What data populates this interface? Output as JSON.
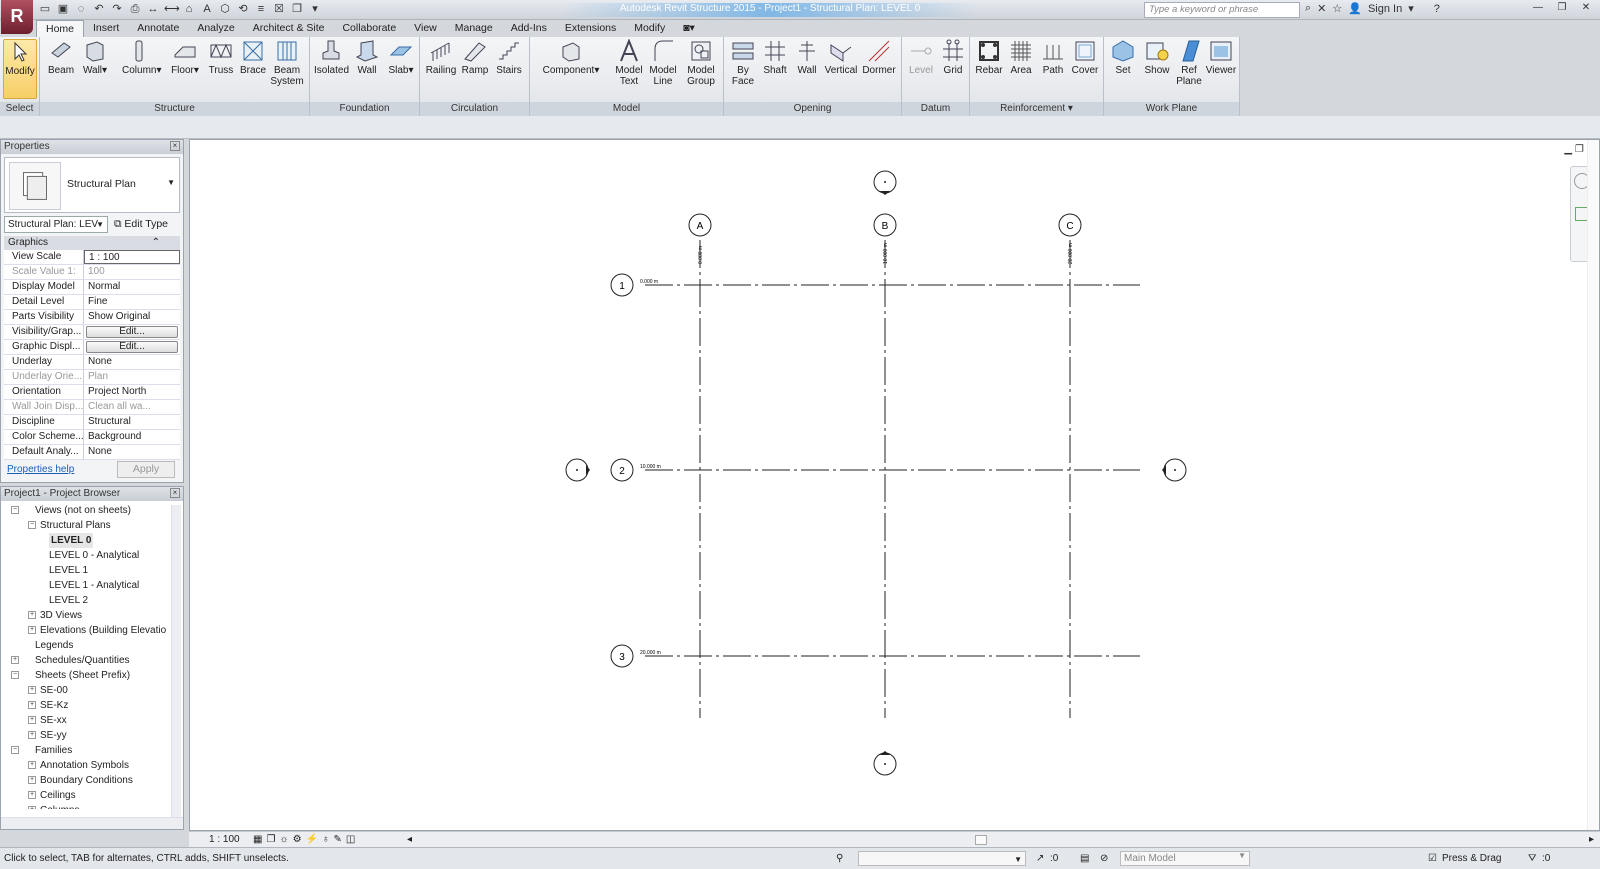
{
  "app": {
    "title": "Autodesk Revit Structure 2015 - Project1 - Structural Plan: LEVEL 0",
    "search_placeholder": "Type a keyword or phrase",
    "sign_in": "Sign In"
  },
  "tabs": [
    "Home",
    "Insert",
    "Annotate",
    "Analyze",
    "Architect & Site",
    "Collaborate",
    "View",
    "Manage",
    "Add-Ins",
    "Extensions",
    "Modify"
  ],
  "ribbon": {
    "panels": {
      "select": "Select",
      "structure": "Structure",
      "foundation": "Foundation",
      "circulation": "Circulation",
      "model": "Model",
      "opening": "Opening",
      "datum": "Datum",
      "reinforcement": "Reinforcement",
      "workplane": "Work Plane"
    },
    "tools": {
      "modify": "Modify",
      "beam": "Beam",
      "wall": "Wall",
      "column": "Column",
      "floor": "Floor",
      "truss": "Truss",
      "brace": "Brace",
      "beam_system": "Beam System",
      "isolated": "Isolated",
      "f_wall": "Wall",
      "slab": "Slab",
      "railing": "Railing",
      "ramp": "Ramp",
      "stairs": "Stairs",
      "component": "Component",
      "model_text": "Model Text",
      "model_line": "Model Line",
      "model_group": "Model Group",
      "by_face": "By Face",
      "shaft": "Shaft",
      "o_wall": "Wall",
      "vertical": "Vertical",
      "dormer": "Dormer",
      "level": "Level",
      "grid": "Grid",
      "rebar": "Rebar",
      "area": "Area",
      "path": "Path",
      "cover": "Cover",
      "set": "Set",
      "show": "Show",
      "ref_plane": "Ref Plane",
      "viewer": "Viewer"
    }
  },
  "properties": {
    "title": "Properties",
    "type_name": "Structural Plan",
    "instance_selector": "Structural Plan: LEV",
    "edit_type": "Edit Type",
    "group": "Graphics",
    "rows": [
      {
        "k": "View Scale",
        "v": "1 : 100"
      },
      {
        "k": "Scale Value   1:",
        "v": "100"
      },
      {
        "k": "Display Model",
        "v": "Normal"
      },
      {
        "k": "Detail Level",
        "v": "Fine"
      },
      {
        "k": "Parts Visibility",
        "v": "Show Original"
      },
      {
        "k": "Visibility/Grap...",
        "v": "Edit..."
      },
      {
        "k": "Graphic Displ...",
        "v": "Edit..."
      },
      {
        "k": "Underlay",
        "v": "None"
      },
      {
        "k": "Underlay Orie...",
        "v": "Plan"
      },
      {
        "k": "Orientation",
        "v": "Project North"
      },
      {
        "k": "Wall Join Disp...",
        "v": "Clean all wa..."
      },
      {
        "k": "Discipline",
        "v": "Structural"
      },
      {
        "k": "Color Scheme...",
        "v": "Background"
      },
      {
        "k": "Default Analy...",
        "v": "None"
      }
    ],
    "help": "Properties help",
    "apply": "Apply"
  },
  "browser": {
    "title": "Project1 - Project Browser",
    "items": [
      {
        "label": "Views (not on sheets)",
        "level": 0,
        "exp": "-"
      },
      {
        "label": "Structural Plans",
        "level": 1,
        "exp": "-"
      },
      {
        "label": "LEVEL 0",
        "level": 2,
        "exp": "",
        "bold": true
      },
      {
        "label": "LEVEL 0 - Analytical",
        "level": 2,
        "exp": ""
      },
      {
        "label": "LEVEL 1",
        "level": 2,
        "exp": ""
      },
      {
        "label": "LEVEL 1 - Analytical",
        "level": 2,
        "exp": ""
      },
      {
        "label": "LEVEL 2",
        "level": 2,
        "exp": ""
      },
      {
        "label": "3D Views",
        "level": 1,
        "exp": "+"
      },
      {
        "label": "Elevations (Building Elevatio",
        "level": 1,
        "exp": "+"
      },
      {
        "label": "Legends",
        "level": 0,
        "exp": ""
      },
      {
        "label": "Schedules/Quantities",
        "level": 0,
        "exp": "+"
      },
      {
        "label": "Sheets (Sheet Prefix)",
        "level": 0,
        "exp": "-"
      },
      {
        "label": "SE-00",
        "level": 1,
        "exp": "+"
      },
      {
        "label": "SE-Kz",
        "level": 1,
        "exp": "+"
      },
      {
        "label": "SE-xx",
        "level": 1,
        "exp": "+"
      },
      {
        "label": "SE-yy",
        "level": 1,
        "exp": "+"
      },
      {
        "label": "Families",
        "level": 0,
        "exp": "-"
      },
      {
        "label": "Annotation Symbols",
        "level": 1,
        "exp": "+"
      },
      {
        "label": "Boundary Conditions",
        "level": 1,
        "exp": "+"
      },
      {
        "label": "Ceilings",
        "level": 1,
        "exp": "+"
      },
      {
        "label": "Columns",
        "level": 1,
        "exp": "+"
      }
    ]
  },
  "drawing": {
    "grids_vertical": [
      {
        "label": "A",
        "dim": "0.000 m"
      },
      {
        "label": "B",
        "dim": "10.000 m"
      },
      {
        "label": "C",
        "dim": "20.000 m"
      }
    ],
    "grids_horizontal": [
      {
        "label": "1",
        "dim": "0.000 m"
      },
      {
        "label": "2",
        "dim": "10.000 m"
      },
      {
        "label": "3",
        "dim": "20.000 m"
      }
    ]
  },
  "view_bar": {
    "scale": "1 : 100"
  },
  "status": {
    "message": "Click to select, TAB for alternates, CTRL adds, SHIFT unselects.",
    "count": ":0",
    "model": "Main Model",
    "press_drag": "Press & Drag",
    "filter_count": ":0"
  }
}
